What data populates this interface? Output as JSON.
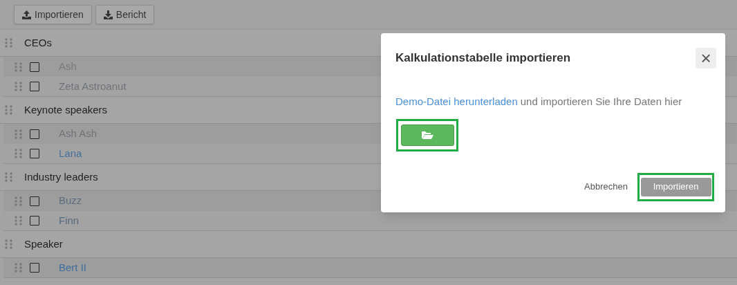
{
  "toolbar": {
    "buttons": [
      {
        "label": "Importieren",
        "kind": "upload"
      },
      {
        "label": "Bericht",
        "kind": "download"
      }
    ]
  },
  "groups": [
    {
      "name": "CEOs",
      "items": [
        {
          "name": "Ash",
          "checked": false,
          "color": "#7a7a7a"
        },
        {
          "name": "Zeta Astroanut",
          "checked": false,
          "color": "#6f7378"
        }
      ]
    },
    {
      "name": "Keynote speakers",
      "items": [
        {
          "name": "Ash Ash",
          "checked": false,
          "color": "#6f7378"
        },
        {
          "name": "Lana",
          "checked": false,
          "color": "#46709a"
        }
      ]
    },
    {
      "name": "Industry leaders",
      "items": [
        {
          "name": "Buzz",
          "checked": false,
          "color": "#5b6c7e"
        },
        {
          "name": "Finn",
          "checked": false,
          "color": "#54697f"
        }
      ]
    },
    {
      "name": "Speaker",
      "items": [
        {
          "name": "Bert II",
          "checked": false,
          "color": "#3f6d9c"
        }
      ]
    }
  ],
  "dialog": {
    "title": "Kalkulationstabelle importieren",
    "close": "×",
    "link": "Demo-Datei herunterladen",
    "text": "und importieren Sie Ihre Daten hier",
    "cancel": "Abbrechen",
    "submit": "Importieren"
  }
}
